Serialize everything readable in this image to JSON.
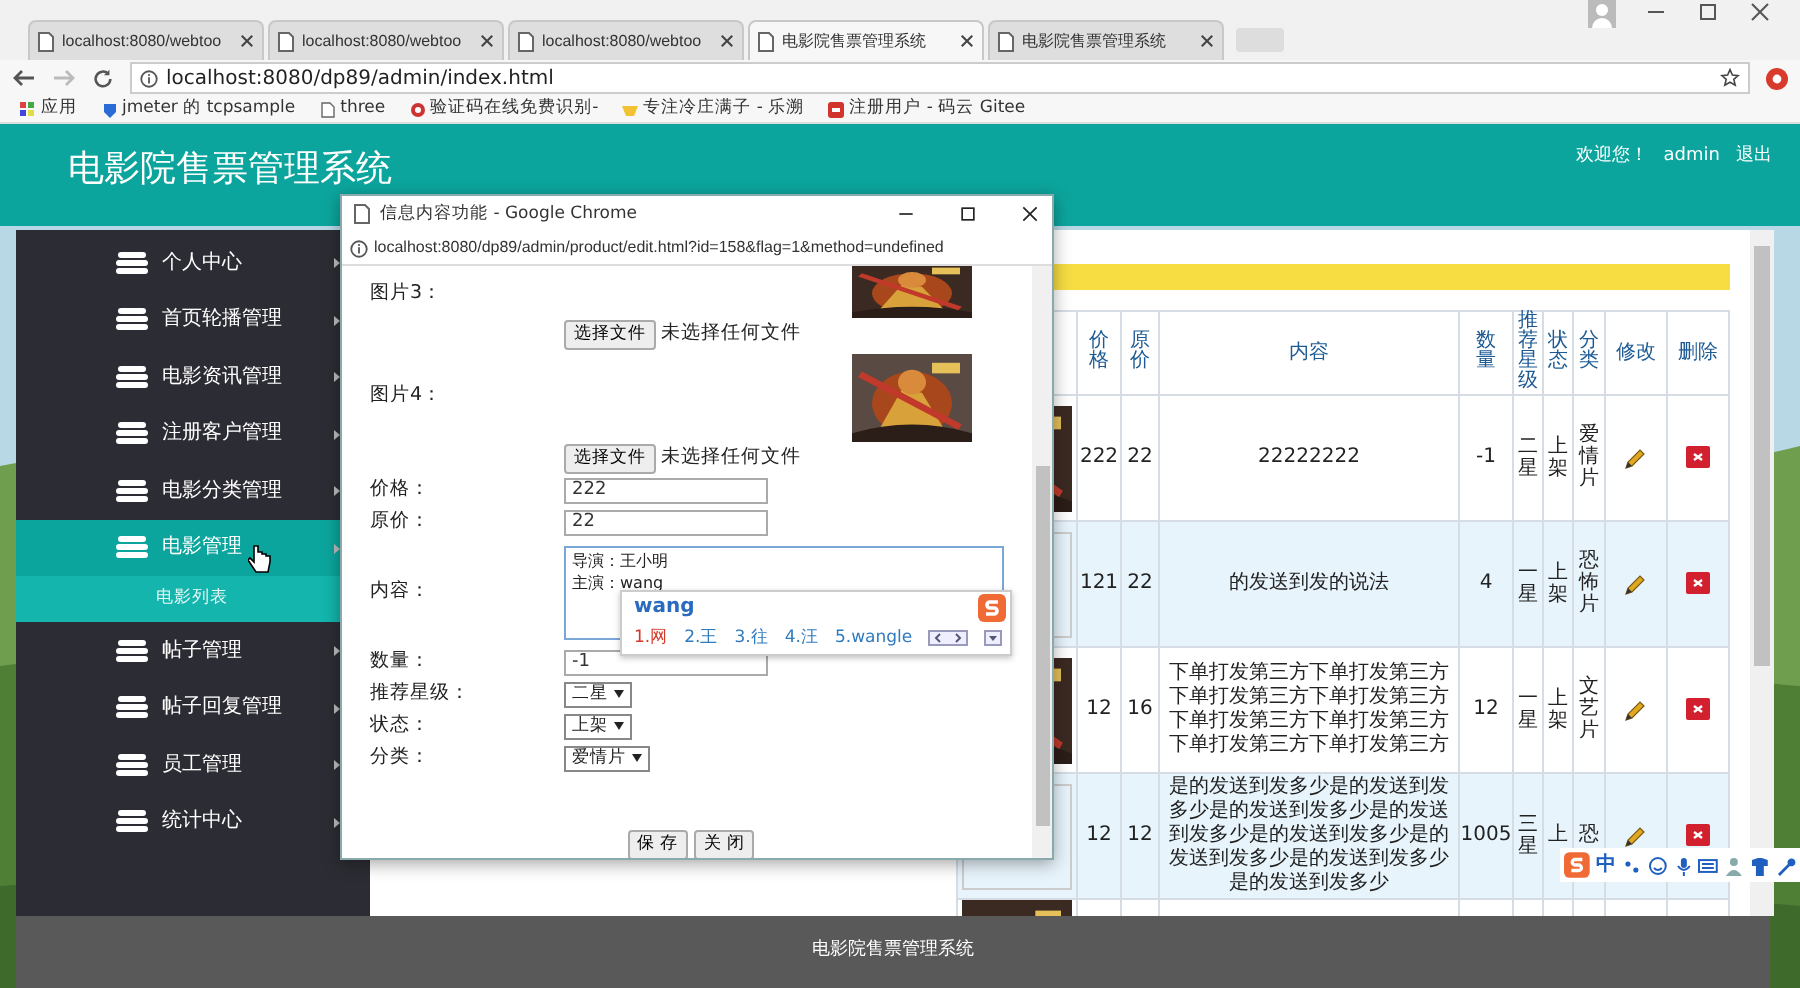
{
  "browser": {
    "tabs": [
      {
        "title": "localhost:8080/webtoo",
        "selected": false
      },
      {
        "title": "localhost:8080/webtoo",
        "selected": false
      },
      {
        "title": "localhost:8080/webtoo",
        "selected": false
      },
      {
        "title": "电影院售票管理系统",
        "selected": true
      },
      {
        "title": "电影院售票管理系统",
        "selected": false
      }
    ],
    "address": "localhost:8080/dp89/admin/index.html",
    "bookmarks": [
      "应用",
      "jmeter 的 tcpsample",
      "three",
      "验证码在线免费识别-",
      "专注冷庄满子 - 乐溯",
      "注册用户 - 码云 Gitee"
    ]
  },
  "header": {
    "title": "电影院售票管理系统",
    "welcome": "欢迎您！",
    "user": "admin",
    "logout": "退出"
  },
  "sidebar": {
    "items": [
      {
        "label": "个人中心",
        "selected": false
      },
      {
        "label": "首页轮播管理",
        "selected": false
      },
      {
        "label": "电影资讯管理",
        "selected": false
      },
      {
        "label": "注册客户管理",
        "selected": false
      },
      {
        "label": "电影分类管理",
        "selected": false
      },
      {
        "label": "电影管理",
        "selected": true,
        "children": [
          {
            "label": "电影列表",
            "selected": false
          }
        ]
      },
      {
        "label": "帖子管理",
        "selected": false
      },
      {
        "label": "帖子回复管理",
        "selected": false
      },
      {
        "label": "员工管理",
        "selected": false
      },
      {
        "label": "统计中心",
        "selected": false
      }
    ]
  },
  "table": {
    "columns": [
      "价格",
      "原价",
      "内容",
      "数量",
      "推荐星级",
      "状态",
      "分类",
      "修改",
      "删除"
    ],
    "rows": [
      {
        "image": {
          "kind": "picture"
        },
        "price": "222",
        "original_price": "22",
        "content": "22222222",
        "quantity": "-1",
        "stars_label": "二星",
        "status": "上架",
        "category": "爱情片"
      },
      {
        "image": {
          "kind": "empty"
        },
        "price": "121",
        "original_price": "22",
        "content": "的发送到发的说法",
        "quantity": "4",
        "stars_label": "一星",
        "status": "上架",
        "category": "恐怖片"
      },
      {
        "image": {
          "kind": "picture"
        },
        "price": "12",
        "original_price": "16",
        "content": "下单打发第三方下单打发第三方下单打发第三方下单打发第三方下单打发第三方下单打发第三方下单打发第三方下单打发第三方",
        "quantity": "12",
        "stars_label": "一星",
        "status": "上架",
        "category": "文艺片"
      },
      {
        "image": {
          "kind": "empty"
        },
        "price": "12",
        "original_price": "12",
        "content": "是的发送到发多少是的发送到发多少是的发送到发多少是的发送到发多少是的发送到发多少是的发送到发多少是的发送到发多少是的发送到发多少",
        "quantity": "1005",
        "stars_label": "三星",
        "status": "上",
        "category": "恐"
      },
      {
        "image": {
          "kind": "picture"
        }
      }
    ]
  },
  "dialog": {
    "title": "信息内容功能 - Google Chrome",
    "url": "localhost:8080/dp89/admin/product/edit.html?id=158&flag=1&method=undefined",
    "fields": [
      {
        "label": "图片3：",
        "button": "选择文件",
        "file_status": "未选择任何文件"
      },
      {
        "label": "图片4：",
        "button": "选择文件",
        "file_status": "未选择任何文件"
      },
      {
        "kind": "text",
        "label": "价格：",
        "value": "222"
      },
      {
        "kind": "text",
        "label": "原价：",
        "value": "22"
      },
      {
        "kind": "textarea",
        "label": "内容：",
        "lines": [
          "导演：王小明",
          "主演："
        ],
        "composing": "wang"
      },
      {
        "kind": "text",
        "label": "数量：",
        "value": "-1"
      },
      {
        "kind": "select",
        "label": "推荐星级：",
        "value": "二星"
      },
      {
        "kind": "select",
        "label": "状态：",
        "value": "上架"
      },
      {
        "kind": "select",
        "label": "分类：",
        "value": "爱情片"
      }
    ],
    "buttons": [
      "保 存",
      "关 闭"
    ]
  },
  "ime": {
    "input": "wang",
    "candidates": [
      {
        "text": "1.网",
        "selected": true
      },
      {
        "text": "2.王",
        "selected": false
      },
      {
        "text": "3.往",
        "selected": false
      },
      {
        "text": "4.汪",
        "selected": false
      },
      {
        "text": "5.wangle",
        "selected": false
      }
    ]
  },
  "ime_toolbar": {
    "mode": "中"
  },
  "footer": {
    "text": "电影院售票管理系统"
  }
}
